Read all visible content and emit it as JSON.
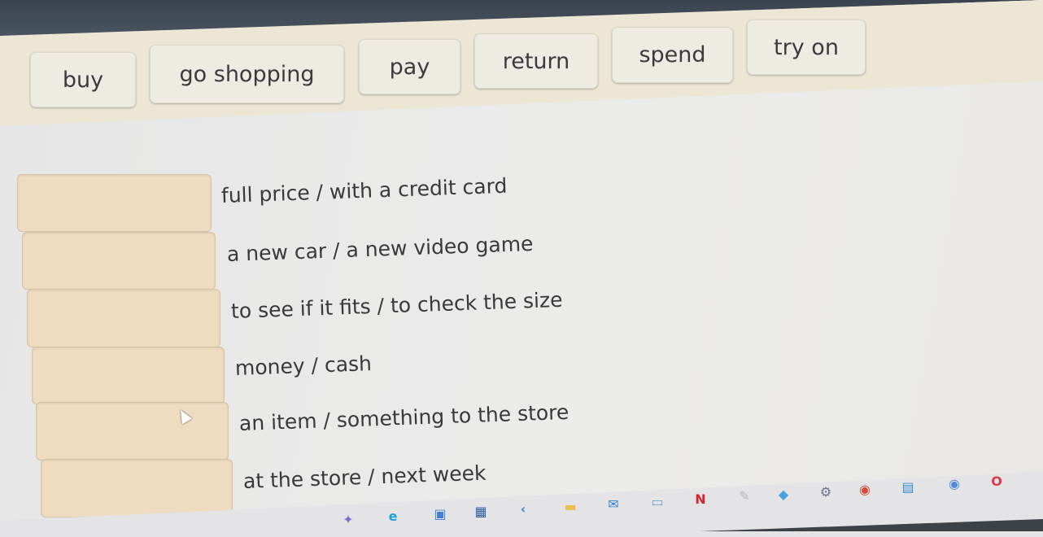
{
  "word_bank": {
    "chips": [
      {
        "label": "buy"
      },
      {
        "label": "go shopping"
      },
      {
        "label": "pay"
      },
      {
        "label": "return"
      },
      {
        "label": "spend"
      },
      {
        "label": "try on"
      }
    ]
  },
  "exercise": {
    "rows": [
      {
        "answer": "",
        "phrase": "full price / with a credit card"
      },
      {
        "answer": "",
        "phrase": "a new car / a new video game"
      },
      {
        "answer": "",
        "phrase": "to see if it fits / to check the size"
      },
      {
        "answer": "",
        "phrase": "money / cash"
      },
      {
        "answer": "",
        "phrase": "an item / something to the store"
      },
      {
        "answer": "",
        "phrase": "at the store / next week"
      }
    ]
  },
  "taskbar": {
    "icons": [
      {
        "name": "copilot-icon",
        "glyph": "✦",
        "color": "#7b6fd6"
      },
      {
        "name": "edge-icon",
        "glyph": "e",
        "color": "#1f9fd8"
      },
      {
        "name": "teams-icon",
        "glyph": "▣",
        "color": "#3f7fd8"
      },
      {
        "name": "store-icon",
        "glyph": "▦",
        "color": "#2d5fa8"
      },
      {
        "name": "vscode-icon",
        "glyph": "‹",
        "color": "#3a8be0"
      },
      {
        "name": "file-explorer-icon",
        "glyph": "▬",
        "color": "#e8c24a"
      },
      {
        "name": "mail-icon",
        "glyph": "✉",
        "color": "#2a83d4"
      },
      {
        "name": "photos-icon",
        "glyph": "▭",
        "color": "#6aa3c8"
      },
      {
        "name": "netflix-icon",
        "glyph": "N",
        "color": "#d8232a"
      },
      {
        "name": "pen-icon",
        "glyph": "✎",
        "color": "#b9b9b9"
      },
      {
        "name": "design-app-icon",
        "glyph": "◆",
        "color": "#4aa3e0"
      },
      {
        "name": "settings-icon",
        "glyph": "⚙",
        "color": "#6b7584"
      },
      {
        "name": "chrome-icon",
        "glyph": "◉",
        "color": "#d9473b"
      },
      {
        "name": "printer-app-icon",
        "glyph": "▤",
        "color": "#3a8fd0"
      },
      {
        "name": "chrome-profile-icon",
        "glyph": "◉",
        "color": "#4f8be0"
      },
      {
        "name": "opera-icon",
        "glyph": "O",
        "color": "#e0384a"
      }
    ]
  }
}
